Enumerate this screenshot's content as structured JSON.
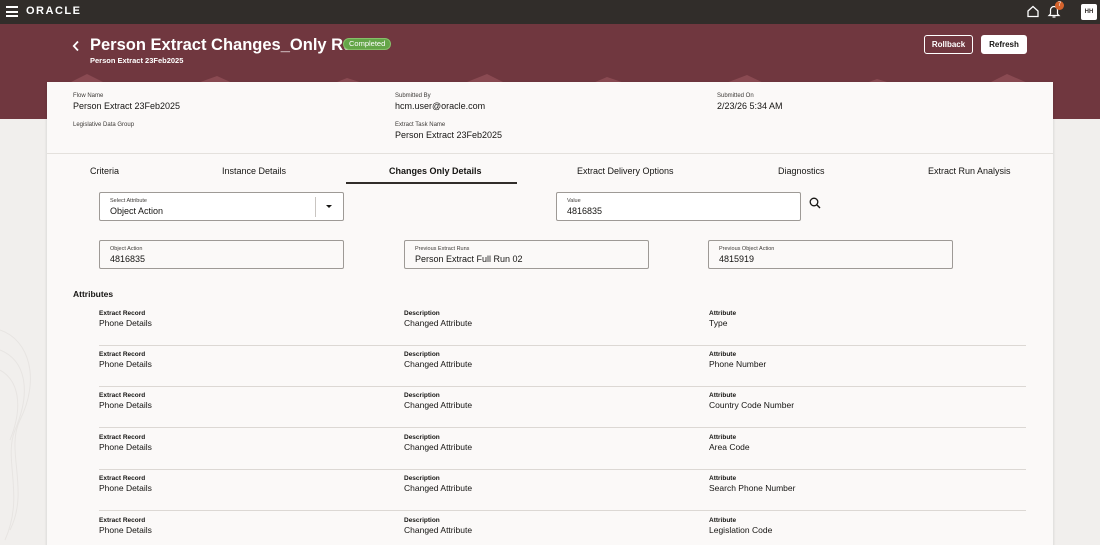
{
  "topbar": {
    "brand": "ORACLE",
    "notification_count": "7",
    "avatar_initials": "HH"
  },
  "header": {
    "title": "Person Extract Changes_Only Run",
    "status": "Completed",
    "subtitle": "Person Extract 23Feb2025",
    "rollback_label": "Rollback",
    "refresh_label": "Refresh"
  },
  "summary": {
    "flow_name_label": "Flow Name",
    "flow_name": "Person Extract 23Feb2025",
    "submitted_by_label": "Submitted By",
    "submitted_by": "hcm.user@oracle.com",
    "submitted_on_label": "Submitted On",
    "submitted_on": "2/23/26 5:34 AM",
    "ldg_label": "Legislative Data Group",
    "extract_task_label": "Extract Task Name",
    "extract_task": "Person Extract 23Feb2025"
  },
  "tabs": [
    {
      "label": "Criteria"
    },
    {
      "label": "Instance Details"
    },
    {
      "label": "Changes Only Details"
    },
    {
      "label": "Extract Delivery Options"
    },
    {
      "label": "Diagnostics"
    },
    {
      "label": "Extract Run Analysis"
    }
  ],
  "filters": {
    "select_attribute_label": "Select Attribute",
    "select_attribute_value": "Object Action",
    "value_label": "Value",
    "value": "4816835"
  },
  "details": {
    "object_action_label": "Object Action",
    "object_action": "4816835",
    "previous_runs_label": "Previous Extract Runs",
    "previous_runs": "Person Extract Full Run 02",
    "previous_object_action_label": "Previous Object Action",
    "previous_object_action": "4815919"
  },
  "attributes": {
    "title": "Attributes",
    "col_record": "Extract Record",
    "col_description": "Description",
    "col_attribute": "Attribute",
    "rows": [
      {
        "record": "Phone Details",
        "description": "Changed Attribute",
        "attribute": "Type"
      },
      {
        "record": "Phone Details",
        "description": "Changed Attribute",
        "attribute": "Phone Number"
      },
      {
        "record": "Phone Details",
        "description": "Changed Attribute",
        "attribute": "Country Code Number"
      },
      {
        "record": "Phone Details",
        "description": "Changed Attribute",
        "attribute": "Area Code"
      },
      {
        "record": "Phone Details",
        "description": "Changed Attribute",
        "attribute": "Search Phone Number"
      },
      {
        "record": "Phone Details",
        "description": "Changed Attribute",
        "attribute": "Legislation Code"
      }
    ]
  },
  "colors": {
    "topbar": "#312d2a",
    "hero": "#70373f",
    "status_green": "#64a548",
    "accent_pattern": "#e7b94a"
  }
}
